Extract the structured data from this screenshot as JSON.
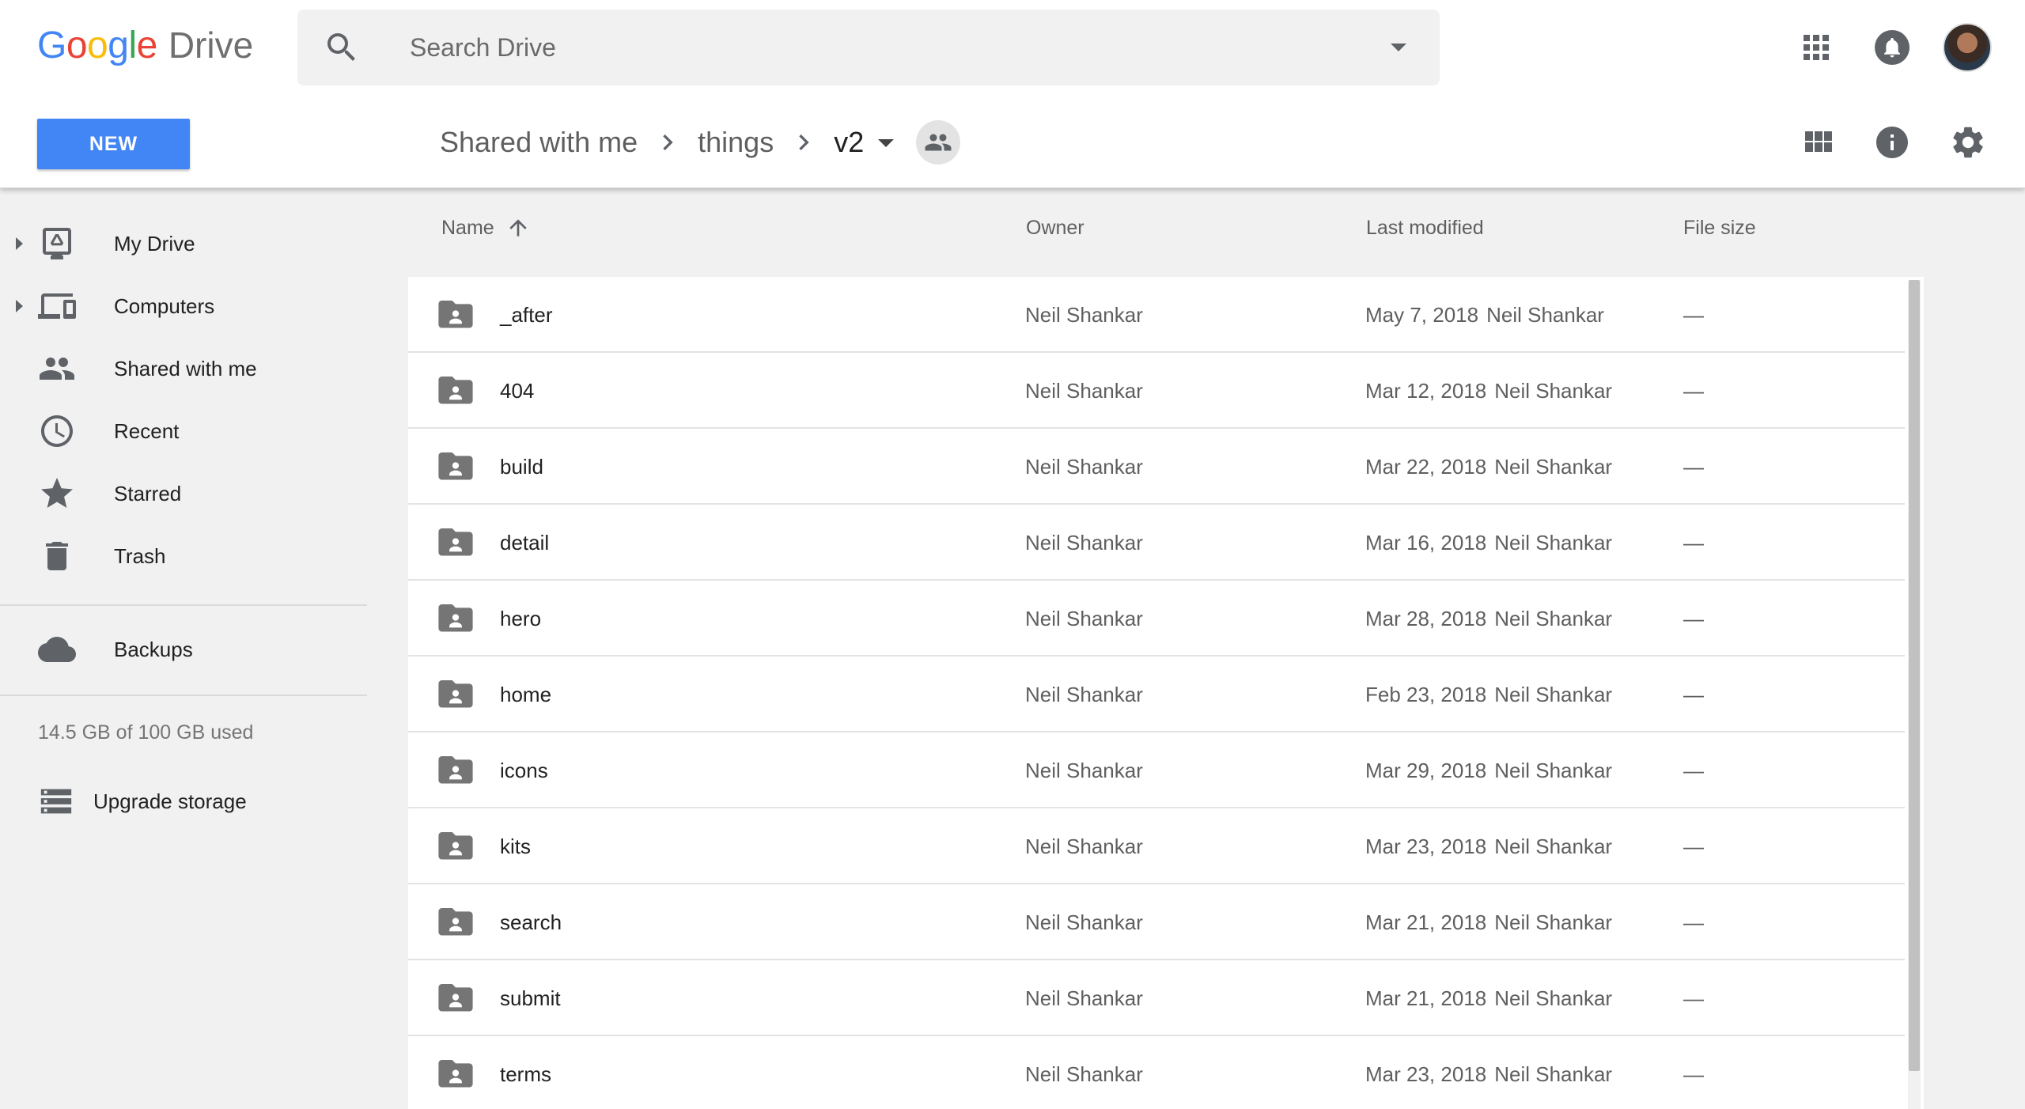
{
  "header": {
    "logo_google": "Google",
    "logo_drive": "Drive",
    "search_placeholder": "Search Drive",
    "new_button": "NEW"
  },
  "breadcrumb": {
    "items": [
      "Shared with me",
      "things",
      "v2"
    ]
  },
  "sidebar": {
    "items": [
      {
        "label": "My Drive",
        "icon": "my-drive-icon"
      },
      {
        "label": "Computers",
        "icon": "computers-icon"
      },
      {
        "label": "Shared with me",
        "icon": "shared-icon"
      },
      {
        "label": "Recent",
        "icon": "clock-icon"
      },
      {
        "label": "Starred",
        "icon": "star-icon"
      },
      {
        "label": "Trash",
        "icon": "trash-icon"
      },
      {
        "label": "Backups",
        "icon": "cloud-icon"
      }
    ],
    "storage_text": "14.5 GB of 100 GB used",
    "upgrade_label": "Upgrade storage"
  },
  "table": {
    "columns": {
      "name": "Name",
      "owner": "Owner",
      "modified": "Last modified",
      "size": "File size"
    },
    "rows": [
      {
        "name": "_after",
        "owner": "Neil Shankar",
        "date": "May 7, 2018",
        "by": "Neil Shankar",
        "size": "—"
      },
      {
        "name": "404",
        "owner": "Neil Shankar",
        "date": "Mar 12, 2018",
        "by": "Neil Shankar",
        "size": "—"
      },
      {
        "name": "build",
        "owner": "Neil Shankar",
        "date": "Mar 22, 2018",
        "by": "Neil Shankar",
        "size": "—"
      },
      {
        "name": "detail",
        "owner": "Neil Shankar",
        "date": "Mar 16, 2018",
        "by": "Neil Shankar",
        "size": "—"
      },
      {
        "name": "hero",
        "owner": "Neil Shankar",
        "date": "Mar 28, 2018",
        "by": "Neil Shankar",
        "size": "—"
      },
      {
        "name": "home",
        "owner": "Neil Shankar",
        "date": "Feb 23, 2018",
        "by": "Neil Shankar",
        "size": "—"
      },
      {
        "name": "icons",
        "owner": "Neil Shankar",
        "date": "Mar 29, 2018",
        "by": "Neil Shankar",
        "size": "—"
      },
      {
        "name": "kits",
        "owner": "Neil Shankar",
        "date": "Mar 23, 2018",
        "by": "Neil Shankar",
        "size": "—"
      },
      {
        "name": "search",
        "owner": "Neil Shankar",
        "date": "Mar 21, 2018",
        "by": "Neil Shankar",
        "size": "—"
      },
      {
        "name": "submit",
        "owner": "Neil Shankar",
        "date": "Mar 21, 2018",
        "by": "Neil Shankar",
        "size": "—"
      },
      {
        "name": "terms",
        "owner": "Neil Shankar",
        "date": "Mar 23, 2018",
        "by": "Neil Shankar",
        "size": "—"
      }
    ]
  },
  "colors": {
    "accent": "#4285f4",
    "sidebar_bg": "#f1f1f1",
    "icon_gray": "#5f6368",
    "folder_gray": "#757575"
  }
}
